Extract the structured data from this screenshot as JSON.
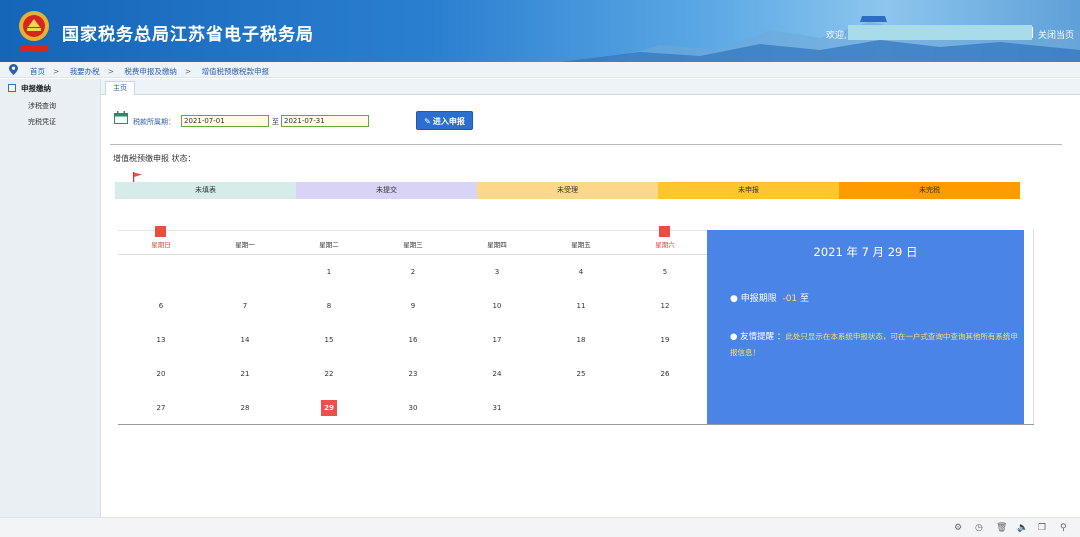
{
  "header": {
    "site_title": "国家税务总局江苏省电子税务局",
    "welcome": "欢迎,",
    "close_page": "关闭当页"
  },
  "breadcrumb": [
    "首页",
    "我要办税",
    "税费申报及缴纳",
    "增值税预缴税款申报"
  ],
  "breadcrumb_sep": ">",
  "sidebar": {
    "heading": "申报缴纳",
    "items": [
      "涉税查询",
      "完税凭证"
    ]
  },
  "tabs": [
    "主页"
  ],
  "period": {
    "label": "税款所属期：",
    "start": "2021-07-01",
    "to": "至",
    "end": "2021-07-31"
  },
  "enter_button": "进入申报",
  "status": {
    "title": "增值税预缴申报 状态：",
    "steps": [
      {
        "label": "未填表",
        "color": "#d6ecea"
      },
      {
        "label": "未提交",
        "color": "#d9d4f7"
      },
      {
        "label": "未受理",
        "color": "#fed88a"
      },
      {
        "label": "未申报",
        "color": "#fec62e"
      },
      {
        "label": "未完税",
        "color": "#ff9a00"
      }
    ]
  },
  "calendar": {
    "weekdays": [
      "星期日",
      "星期一",
      "星期二",
      "星期三",
      "星期四",
      "星期五",
      "星期六"
    ],
    "weeks": [
      [
        "",
        "",
        "1",
        "2",
        "3",
        "4",
        "5"
      ],
      [
        "6",
        "7",
        "8",
        "9",
        "10",
        "11",
        "12"
      ],
      [
        "13",
        "14",
        "15",
        "16",
        "17",
        "18",
        "19"
      ],
      [
        "20",
        "21",
        "22",
        "23",
        "24",
        "25",
        "26"
      ],
      [
        "27",
        "28",
        "29",
        "30",
        "31",
        "",
        ""
      ]
    ],
    "today": "29"
  },
  "info": {
    "date": "2021 年 7 月 29 日",
    "deadline_label": "● 申报期限",
    "deadline_value": "-01",
    "deadline_to": "至",
    "tip_label": "● 友情提醒 ：",
    "tip_text": "此处只显示在本系统申报状态，可在一户式查询中查询其他所有系统申报信息！"
  },
  "footer_icons": [
    "settings-icon",
    "history-icon",
    "trash-icon",
    "volume-icon",
    "copy-icon",
    "search-icon"
  ]
}
